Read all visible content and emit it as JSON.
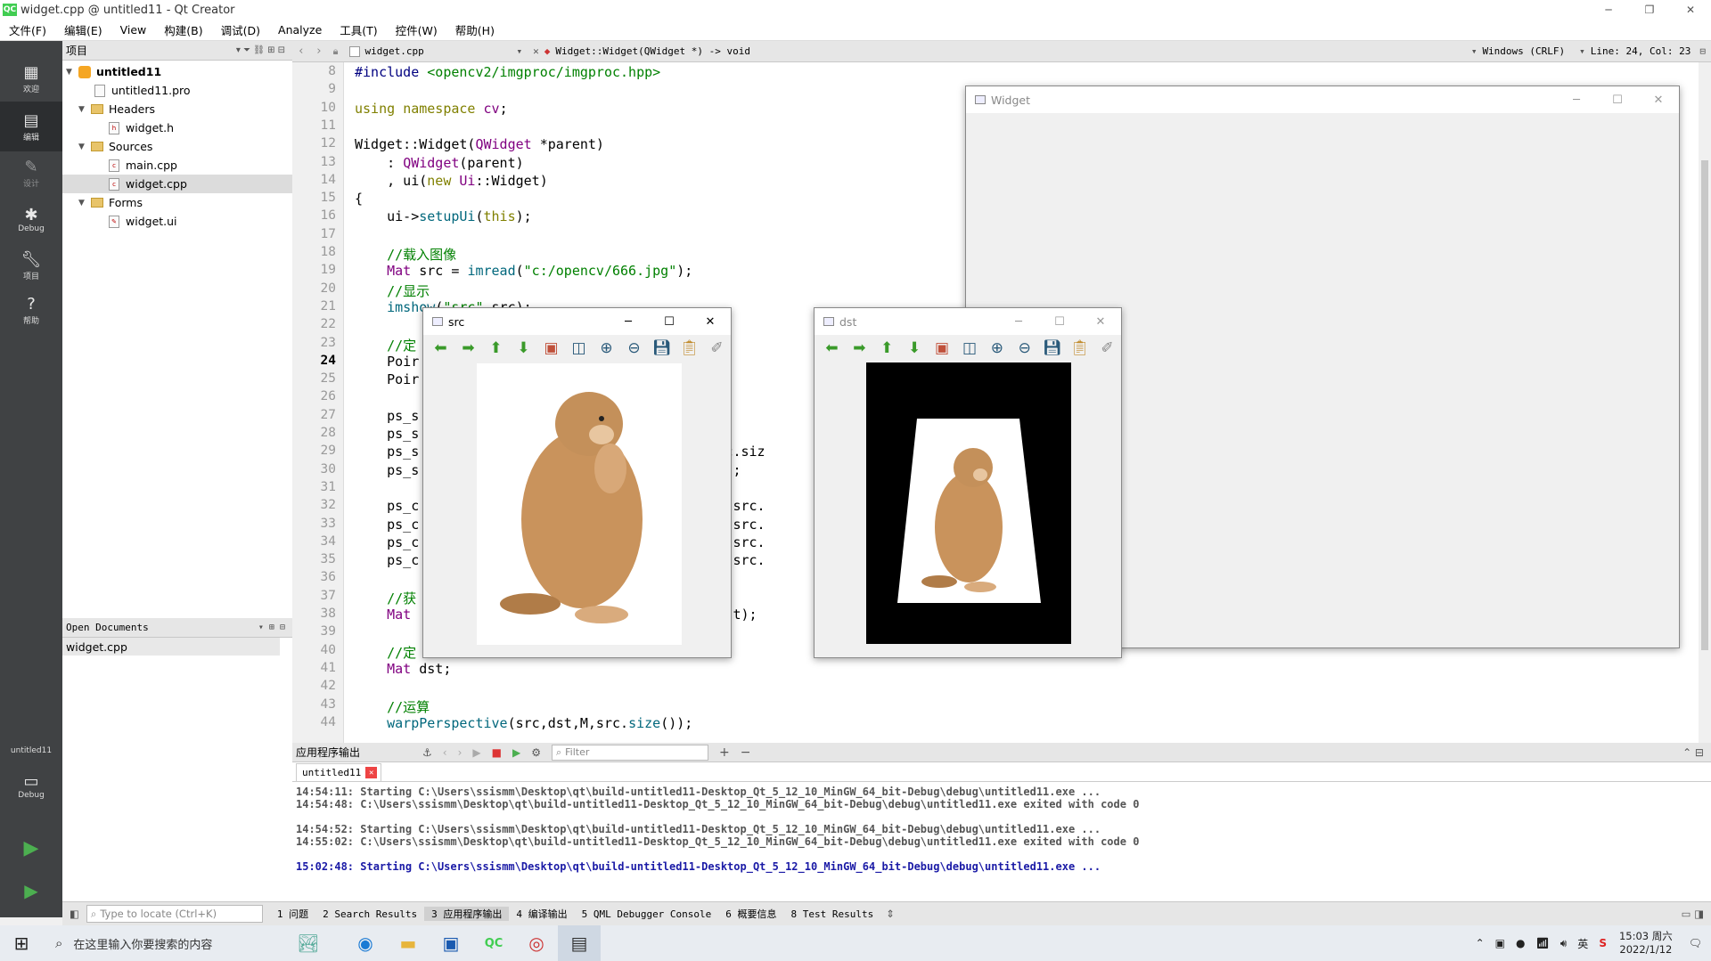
{
  "app": {
    "title": "widget.cpp @ untitled11 - Qt Creator",
    "icon_text": "QC"
  },
  "menu": [
    "文件(F)",
    "编辑(E)",
    "View",
    "构建(B)",
    "调试(D)",
    "Analyze",
    "工具(T)",
    "控件(W)",
    "帮助(H)"
  ],
  "modes": [
    {
      "label": "欢迎",
      "icon": "grid-icon"
    },
    {
      "label": "编辑",
      "icon": "edit-icon"
    },
    {
      "label": "设计",
      "icon": "pencil-icon"
    },
    {
      "label": "Debug",
      "icon": "bug-icon"
    },
    {
      "label": "项目",
      "icon": "wrench-icon"
    },
    {
      "label": "帮助",
      "icon": "help-icon"
    }
  ],
  "kit": {
    "project": "untitled11",
    "config": "Debug"
  },
  "project_pane": {
    "title": "项目",
    "tree": [
      {
        "label": "untitled11"
      },
      {
        "label": "untitled11.pro"
      },
      {
        "label": "Headers"
      },
      {
        "label": "widget.h"
      },
      {
        "label": "Sources"
      },
      {
        "label": "main.cpp"
      },
      {
        "label": "widget.cpp"
      },
      {
        "label": "Forms"
      },
      {
        "label": "widget.ui"
      }
    ]
  },
  "open_docs": {
    "title": "Open Documents",
    "items": [
      "widget.cpp"
    ]
  },
  "editor": {
    "file": "widget.cpp",
    "symbol": "Widget::Widget(QWidget *) -> void",
    "encoding": "Windows (CRLF)",
    "position": "Line: 24, Col: 23",
    "line_numbers": [
      "8",
      "9",
      "10",
      "11",
      "12",
      "13",
      "14",
      "15",
      "16",
      "17",
      "18",
      "19",
      "20",
      "21",
      "22",
      "23",
      "24",
      "25",
      "26",
      "27",
      "28",
      "29",
      "30",
      "31",
      "32",
      "33",
      "34",
      "35",
      "36",
      "37",
      "38",
      "39",
      "40",
      "41",
      "42",
      "43",
      "44"
    ],
    "lines": [
      "#include <opencv2/imgproc/imgproc.hpp>",
      "",
      "using namespace cv;",
      "",
      "Widget::Widget(QWidget *parent)",
      "    : QWidget(parent)",
      "    , ui(new Ui::Widget)",
      "{",
      "    ui->setupUi(this);",
      "",
      "    //载入图像",
      "    Mat src = imread(\"c:/opencv/666.jpg\");",
      "    //显示",
      "    imshow(\"src\",src);",
      "",
      "    //定",
      "    Poir",
      "    Poir",
      "",
      "    ps_s",
      "    ps_s                                  , 0);",
      "    ps_s                                  , src.siz",
      "    ps_s                                 ght-1);",
      "",
      "    ps_c                                 .25 , src.",
      "    ps_c                                 .75 , src.",
      "    ps_c                                 .85 , src.",
      "    ps_c                                 .15 , src.",
      "",
      "    //获",
      "    Mat                                  ,ps_dst);",
      "",
      "    //定",
      "    Mat dst;",
      "",
      "    //运算",
      "    warpPerspective(src,dst,M,src.size());"
    ]
  },
  "windows": {
    "widget": {
      "title": "Widget"
    },
    "src": {
      "title": "src"
    },
    "dst": {
      "title": "dst"
    }
  },
  "output": {
    "title": "应用程序输出",
    "filter_placeholder": "Filter",
    "tab": "untitled11",
    "lines": [
      "14:54:11: Starting C:\\Users\\ssismm\\Desktop\\qt\\build-untitled11-Desktop_Qt_5_12_10_MinGW_64_bit-Debug\\debug\\untitled11.exe ...",
      "14:54:48: C:\\Users\\ssismm\\Desktop\\qt\\build-untitled11-Desktop_Qt_5_12_10_MinGW_64_bit-Debug\\debug\\untitled11.exe exited with code 0",
      "",
      "14:54:52: Starting C:\\Users\\ssismm\\Desktop\\qt\\build-untitled11-Desktop_Qt_5_12_10_MinGW_64_bit-Debug\\debug\\untitled11.exe ...",
      "14:55:02: C:\\Users\\ssismm\\Desktop\\qt\\build-untitled11-Desktop_Qt_5_12_10_MinGW_64_bit-Debug\\debug\\untitled11.exe exited with code 0",
      "",
      "15:02:48: Starting C:\\Users\\ssismm\\Desktop\\qt\\build-untitled11-Desktop_Qt_5_12_10_MinGW_64_bit-Debug\\debug\\untitled11.exe ..."
    ]
  },
  "statusbar": {
    "locate_placeholder": "Type to locate (Ctrl+K)",
    "panes": [
      "1 问题",
      "2 Search Results",
      "3 应用程序输出",
      "4 编译输出",
      "5 QML Debugger Console",
      "6 概要信息",
      "8 Test Results"
    ]
  },
  "taskbar": {
    "search_placeholder": "在这里输入你要搜索的内容",
    "ime": "英",
    "time": "15:03 周六",
    "date": "2022/1/12"
  }
}
